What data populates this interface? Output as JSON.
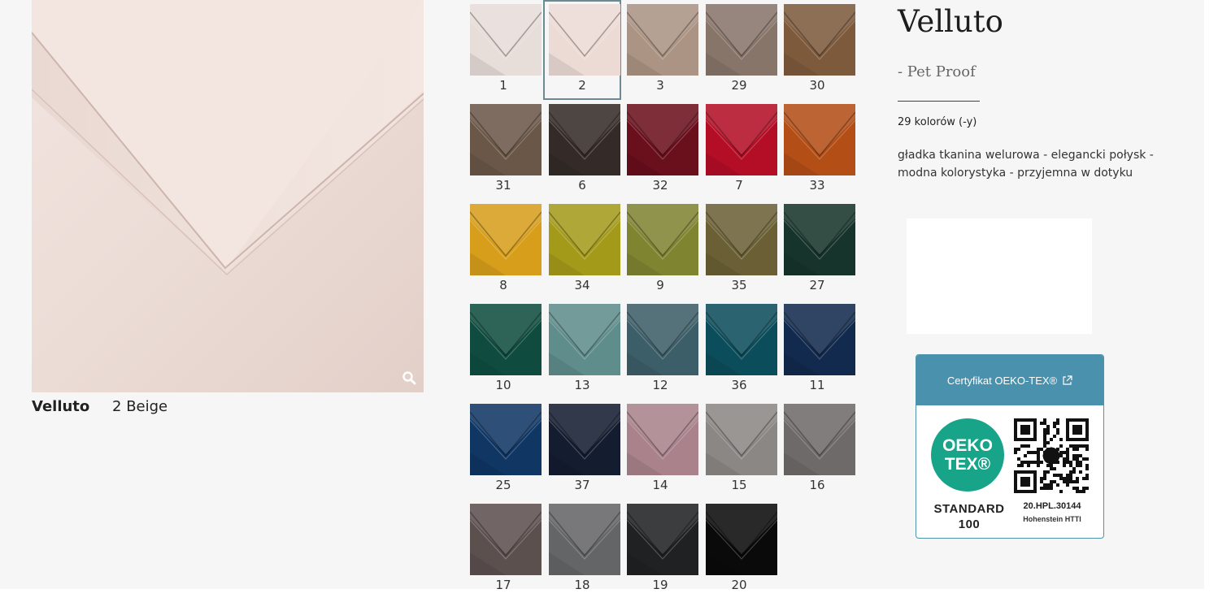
{
  "product": {
    "title": "Velluto",
    "subtitle": "- Pet Proof",
    "colors_count": "29 kolorów (-y)",
    "description": "gładka tkanina welurowa - elegancki połysk - modna kolorystyka - przyjemna w dotyku"
  },
  "main_image": {
    "color": "#ecdcd6",
    "zoom_icon": "search-icon"
  },
  "caption": {
    "name": "Velluto",
    "variant": "2 Beige"
  },
  "swatches": [
    {
      "num": "1",
      "color": "#e7ddd9",
      "selected": false
    },
    {
      "num": "2",
      "color": "#ecdbd5",
      "selected": true
    },
    {
      "num": "3",
      "color": "#ab9483",
      "selected": false
    },
    {
      "num": "29",
      "color": "#87756a",
      "selected": false
    },
    {
      "num": "30",
      "color": "#7d5a3c",
      "selected": false
    },
    {
      "num": "31",
      "color": "#6a5748",
      "selected": false
    },
    {
      "num": "6",
      "color": "#342b28",
      "selected": false
    },
    {
      "num": "32",
      "color": "#6a0f1c",
      "selected": false
    },
    {
      "num": "7",
      "color": "#b30e26",
      "selected": false
    },
    {
      "num": "33",
      "color": "#b34e16",
      "selected": false
    },
    {
      "num": "8",
      "color": "#d79e1b",
      "selected": false
    },
    {
      "num": "34",
      "color": "#a49a1a",
      "selected": false
    },
    {
      "num": "9",
      "color": "#7f8431",
      "selected": false
    },
    {
      "num": "35",
      "color": "#6b6035",
      "selected": false
    },
    {
      "num": "27",
      "color": "#16342b",
      "selected": false
    },
    {
      "num": "10",
      "color": "#0f4c3f",
      "selected": false
    },
    {
      "num": "13",
      "color": "#5f8d8c",
      "selected": false
    },
    {
      "num": "12",
      "color": "#3c5e68",
      "selected": false
    },
    {
      "num": "36",
      "color": "#0c4d5b",
      "selected": false
    },
    {
      "num": "11",
      "color": "#122a4e",
      "selected": false
    },
    {
      "num": "25",
      "color": "#103664",
      "selected": false
    },
    {
      "num": "37",
      "color": "#141c30",
      "selected": false
    },
    {
      "num": "14",
      "color": "#a9828b",
      "selected": false
    },
    {
      "num": "15",
      "color": "#8a8784",
      "selected": false
    },
    {
      "num": "16",
      "color": "#6e6a69",
      "selected": false
    },
    {
      "num": "17",
      "color": "#5c504f",
      "selected": false
    },
    {
      "num": "18",
      "color": "#646567",
      "selected": false
    },
    {
      "num": "19",
      "color": "#202123",
      "selected": false
    },
    {
      "num": "20",
      "color": "#0a0a0a",
      "selected": false
    }
  ],
  "certificate": {
    "link_label": "Certyfikat OEKO-TEX®",
    "link_icon": "external-link-icon",
    "logo_line1": "OEKO",
    "logo_line2": "TEX®",
    "standard_line1": "STANDARD",
    "standard_line2": "100",
    "code": "20.HPL.30144",
    "lab": "Hohenstein HTTI",
    "qr_icon": "qr-code-icon",
    "header_color": "#4a91ae",
    "logo_color": "#17a489"
  }
}
